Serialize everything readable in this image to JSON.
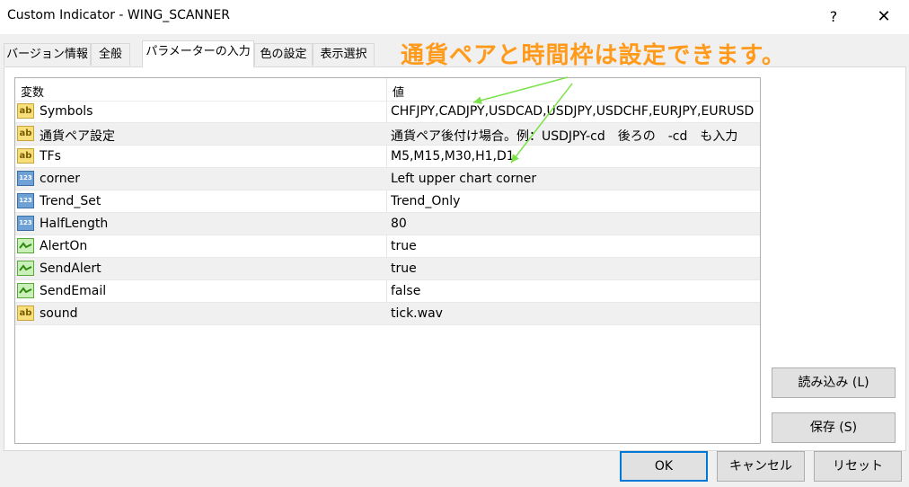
{
  "window": {
    "title": "Custom Indicator - WING_SCANNER",
    "help": "?",
    "close": "✕"
  },
  "tabs": [
    {
      "label": "バージョン情報"
    },
    {
      "label": "全般"
    },
    {
      "label": "パラメーターの入力",
      "active": true
    },
    {
      "label": "色の設定"
    },
    {
      "label": "表示選択"
    }
  ],
  "annotation": "通貨ペアと時間枠は設定できます。",
  "table": {
    "headers": {
      "name": "変数",
      "value": "値"
    },
    "rows": [
      {
        "type": "ab",
        "icon": "string-type-icon",
        "name": "Symbols",
        "value": "CHFJPY,CADJPY,USDCAD,USDJPY,USDCHF,EURJPY,EURUSD,E..."
      },
      {
        "type": "ab",
        "icon": "string-type-icon",
        "name": "通貨ペア設定",
        "value": "通貨ペア後付け場合。例：USDJPY-cd　後ろの　-cd　も入力"
      },
      {
        "type": "ab",
        "icon": "string-type-icon",
        "name": "TFs",
        "value": "M5,M15,M30,H1,D1"
      },
      {
        "type": "123",
        "icon": "integer-type-icon",
        "name": "corner",
        "value": "Left upper chart corner"
      },
      {
        "type": "123",
        "icon": "integer-type-icon",
        "name": "Trend_Set",
        "value": "Trend_Only"
      },
      {
        "type": "123",
        "icon": "integer-type-icon",
        "name": "HalfLength",
        "value": "80"
      },
      {
        "type": "bool",
        "icon": "boolean-type-icon",
        "name": "AlertOn",
        "value": "true"
      },
      {
        "type": "bool",
        "icon": "boolean-type-icon",
        "name": "SendAlert",
        "value": "true"
      },
      {
        "type": "bool",
        "icon": "boolean-type-icon",
        "name": "SendEmail",
        "value": "false"
      },
      {
        "type": "ab",
        "icon": "string-type-icon",
        "name": "sound",
        "value": "tick.wav"
      }
    ]
  },
  "buttons": {
    "load": "読み込み (L)",
    "save": "保存 (S)",
    "ok": "OK",
    "cancel": "キャンセル",
    "reset": "リセット"
  },
  "colors": {
    "annotation": "#ff9a1a",
    "arrow": "#7be34a",
    "default_button_border": "#0078d7"
  }
}
